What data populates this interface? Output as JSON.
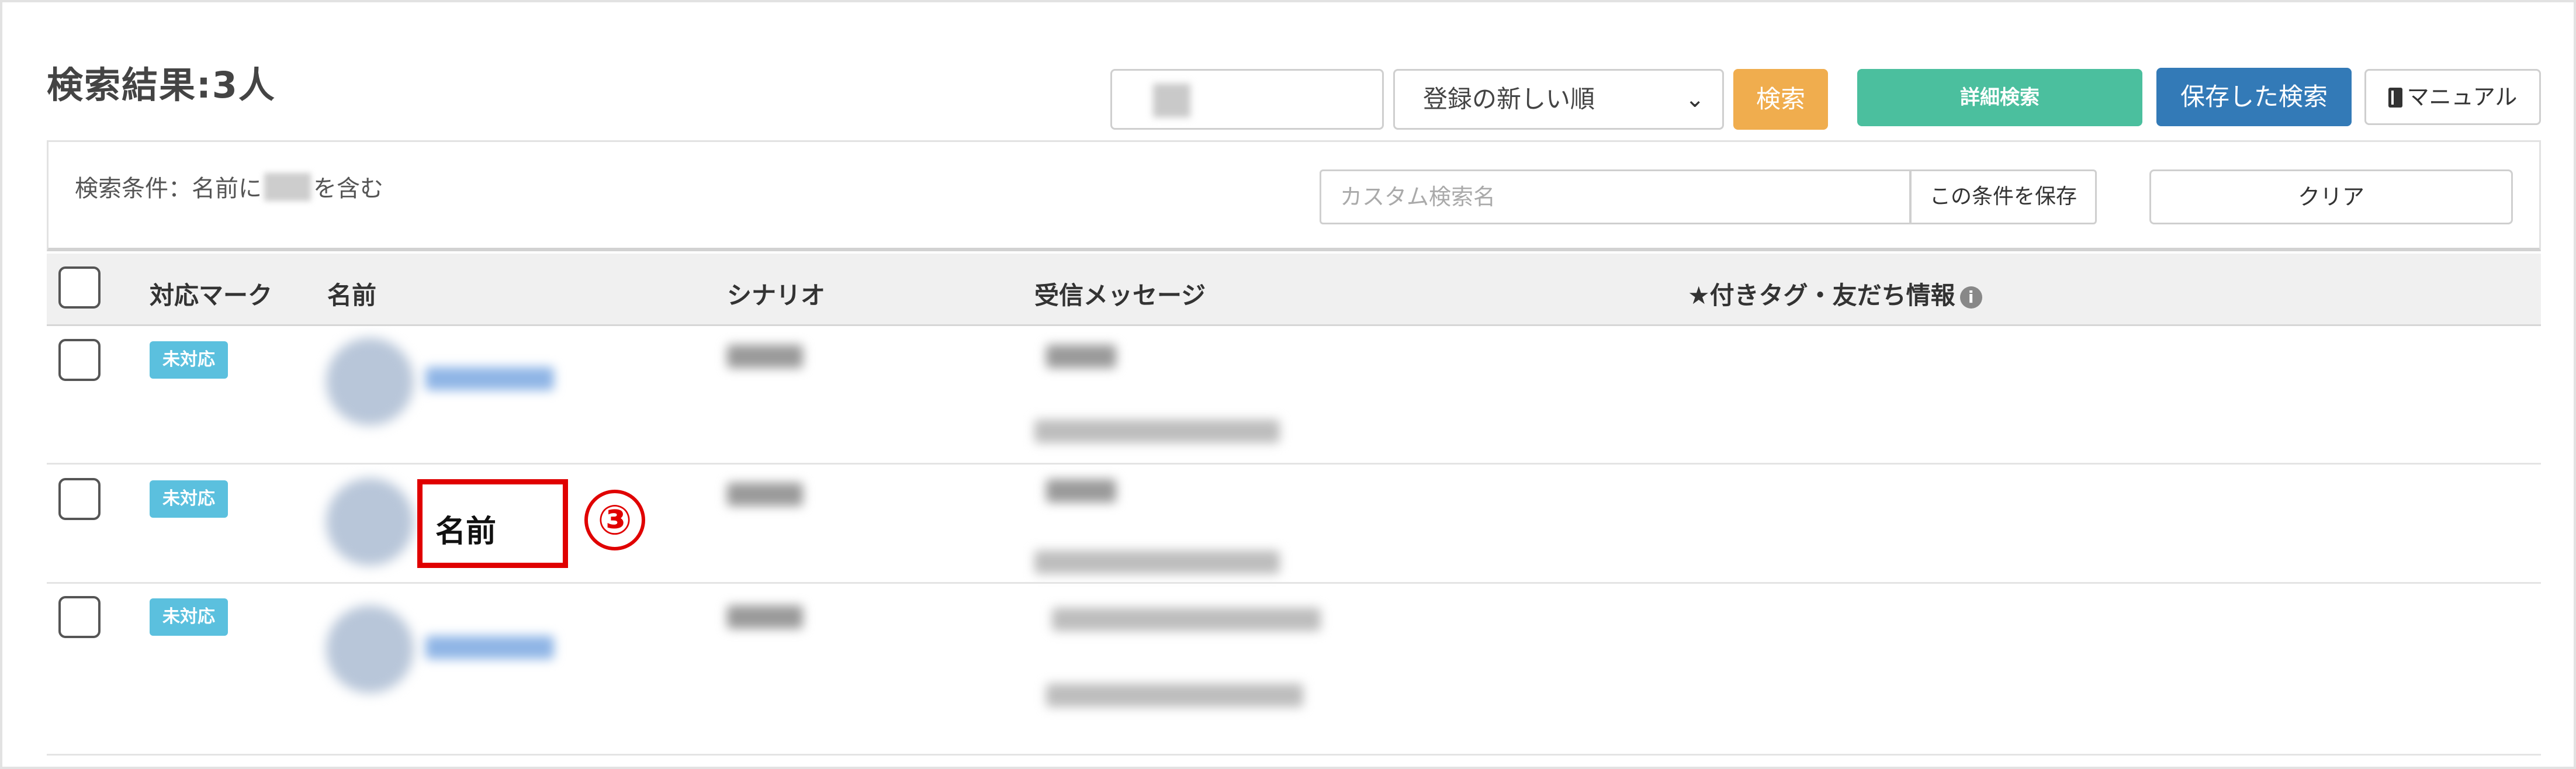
{
  "header": {
    "title": "検索結果:3人"
  },
  "toolbar": {
    "sort_value": "登録の新しい順",
    "search_label": "検索",
    "detail_search_label": "詳細検索",
    "saved_search_label": "保存した検索",
    "manual_label": "マニュアル"
  },
  "conditions": {
    "prefix": "検索条件：名前に",
    "suffix": "を含む",
    "custom_name_placeholder": "カスタム検索名",
    "save_label": "この条件を保存",
    "clear_label": "クリア"
  },
  "table": {
    "columns": [
      "対応マーク",
      "名前",
      "シナリオ",
      "受信メッセージ",
      "★付きタグ・友だち情報"
    ],
    "rows": [
      {
        "status": "未対応"
      },
      {
        "status": "未対応"
      },
      {
        "status": "未対応"
      }
    ]
  },
  "annotation": {
    "label": "名前",
    "number": "③"
  },
  "colors": {
    "search_button": "#f0ad4e",
    "detail_button": "#4bbf9e",
    "saved_button": "#337ab7",
    "status_badge": "#5bc0de",
    "annotation": "#e00000"
  }
}
